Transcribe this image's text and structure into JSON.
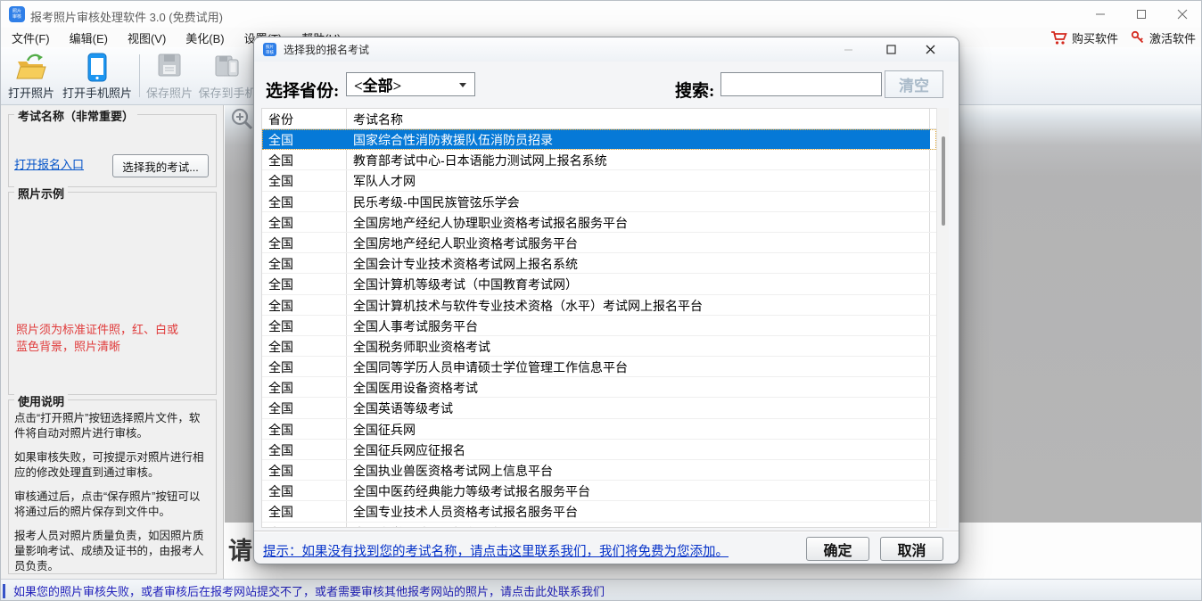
{
  "colors": {
    "selection_blue": "#0679d7",
    "link_blue": "#0453c8",
    "red_text": "#e03a3a",
    "status_blue": "#2222bb",
    "icon_red": "#d4291e"
  },
  "window": {
    "title": "报考照片审核处理软件 3.0 (免费试用)",
    "app_icon_text": "照片 审核"
  },
  "menu_bar": {
    "items": [
      "文件(F)",
      "编辑(E)",
      "视图(V)",
      "美化(B)",
      "设置(T)",
      "帮助(H)"
    ],
    "buy_label": "购买软件",
    "activate_label": "激活软件"
  },
  "toolbar": {
    "buttons": [
      {
        "label": "打开照片",
        "enabled": true
      },
      {
        "label": "打开手机照片",
        "enabled": true
      },
      {
        "label": "保存照片",
        "enabled": false
      },
      {
        "label": "保存到手机",
        "enabled": false
      }
    ]
  },
  "left_panel": {
    "exam_group_title": "考试名称（非常重要）",
    "open_entry_link": "打开报名入口",
    "choose_exam_button": "选择我的考试...",
    "photo_example_title": "照片示例",
    "photo_note_lines": [
      "照片须为标准证件照，红、白或",
      "蓝色背景，照片清晰"
    ],
    "usage_title": "使用说明",
    "usage_paragraphs": [
      "点击“打开照片”按钮选择照片文件，软件将自动对照片进行审核。",
      "如果审核失败，可按提示对照片进行相应的修改处理直到通过审核。",
      "审核通过后，点击“保存照片”按钮可以将通过后的照片保存到文件中。",
      "报考人员对照片质量负责，如因照片质量影响考试、成绩及证书的，由报考人员负责。"
    ]
  },
  "canvas": {
    "hint_partial": "请"
  },
  "status_bar": {
    "text": "如果您的照片审核失败，或者审核后在报考网站提交不了，或者需要审核其他报考网站的照片，请点击此处联系我们"
  },
  "dialog": {
    "title": "选择我的报名考试",
    "province_label": "选择省份:",
    "province_value": "<全部>",
    "search_label": "搜索:",
    "search_value": "",
    "clear_button": "清空",
    "table": {
      "headers": [
        "省份",
        "考试名称"
      ],
      "rows": [
        {
          "province": "全国",
          "name": "国家综合性消防救援队伍消防员招录",
          "selected": true
        },
        {
          "province": "全国",
          "name": "教育部考试中心-日本语能力测试网上报名系统"
        },
        {
          "province": "全国",
          "name": "军队人才网"
        },
        {
          "province": "全国",
          "name": "民乐考级-中国民族管弦乐学会"
        },
        {
          "province": "全国",
          "name": "全国房地产经纪人协理职业资格考试报名服务平台"
        },
        {
          "province": "全国",
          "name": "全国房地产经纪人职业资格考试服务平台"
        },
        {
          "province": "全国",
          "name": "全国会计专业技术资格考试网上报名系统"
        },
        {
          "province": "全国",
          "name": "全国计算机等级考试（中国教育考试网）"
        },
        {
          "province": "全国",
          "name": "全国计算机技术与软件专业技术资格（水平）考试网上报名平台"
        },
        {
          "province": "全国",
          "name": "全国人事考试服务平台"
        },
        {
          "province": "全国",
          "name": "全国税务师职业资格考试"
        },
        {
          "province": "全国",
          "name": "全国同等学历人员申请硕士学位管理工作信息平台"
        },
        {
          "province": "全国",
          "name": "全国医用设备资格考试"
        },
        {
          "province": "全国",
          "name": "全国英语等级考试"
        },
        {
          "province": "全国",
          "name": "全国征兵网"
        },
        {
          "province": "全国",
          "name": "全国征兵网应征报名"
        },
        {
          "province": "全国",
          "name": "全国执业兽医资格考试网上信息平台"
        },
        {
          "province": "全国",
          "name": "全国中医药经典能力等级考试报名服务平台"
        },
        {
          "province": "全国",
          "name": "全国专业技术人员资格考试报名服务平台"
        },
        {
          "province": "全国",
          "name": "全国自学考试网上报名平台",
          "partial": true
        }
      ]
    },
    "tip_link": "提示：如果没有找到您的考试名称，请点击这里联系我们，我们将免费为您添加。",
    "ok_button": "确定",
    "cancel_button": "取消"
  }
}
